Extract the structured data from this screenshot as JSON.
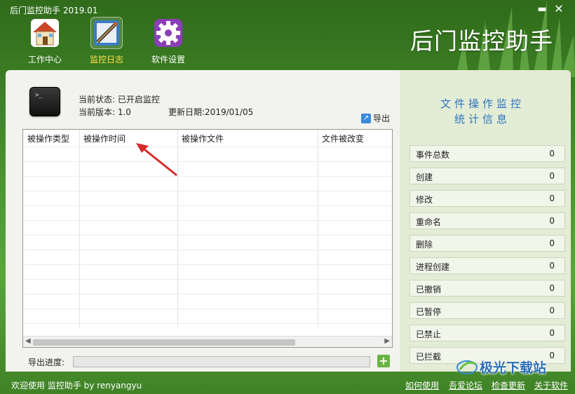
{
  "window": {
    "title": "后门监控助手 2019.01",
    "brand": "后门监控助手"
  },
  "toolbar": {
    "items": [
      {
        "label": "工作中心",
        "icon": "house-icon"
      },
      {
        "label": "监控日志",
        "icon": "log-icon"
      },
      {
        "label": "软件设置",
        "icon": "gear-icon"
      }
    ],
    "active": "监控日志"
  },
  "info": {
    "status": "当前状态: 已开启监控",
    "version": "当前版本: 1.0",
    "update_date": "更新日期:2019/01/05"
  },
  "export_label": "导出",
  "table": {
    "columns": [
      "被操作类型",
      "被操作时间",
      "被操作文件",
      "文件被改变"
    ],
    "rows": []
  },
  "progress": {
    "label": "导出进度:",
    "value": 0
  },
  "stats": {
    "title_line1": "文件操作监控",
    "title_line2": "统计信息",
    "rows": [
      {
        "label": "事件总数",
        "value": "0"
      },
      {
        "label": "创建",
        "value": "0"
      },
      {
        "label": "修改",
        "value": "0"
      },
      {
        "label": "重命名",
        "value": "0"
      },
      {
        "label": "删除",
        "value": "0"
      },
      {
        "label": "进程创建",
        "value": "0"
      },
      {
        "label": "已撤销",
        "value": "0"
      },
      {
        "label": "已暂停",
        "value": "0"
      },
      {
        "label": "已禁止",
        "value": "0"
      },
      {
        "label": "已拦截",
        "value": "0"
      }
    ]
  },
  "statusbar": {
    "text": "欢迎使用 监控助手  by  renyangyu",
    "links": [
      "如何使用",
      "吾爱论坛",
      "检查更新",
      "关于软件"
    ]
  },
  "watermark": {
    "text": "极光下载站"
  },
  "colors": {
    "accent": "#2f74c0",
    "frame_green": "#4b9430",
    "active_label": "#ffe14d"
  }
}
